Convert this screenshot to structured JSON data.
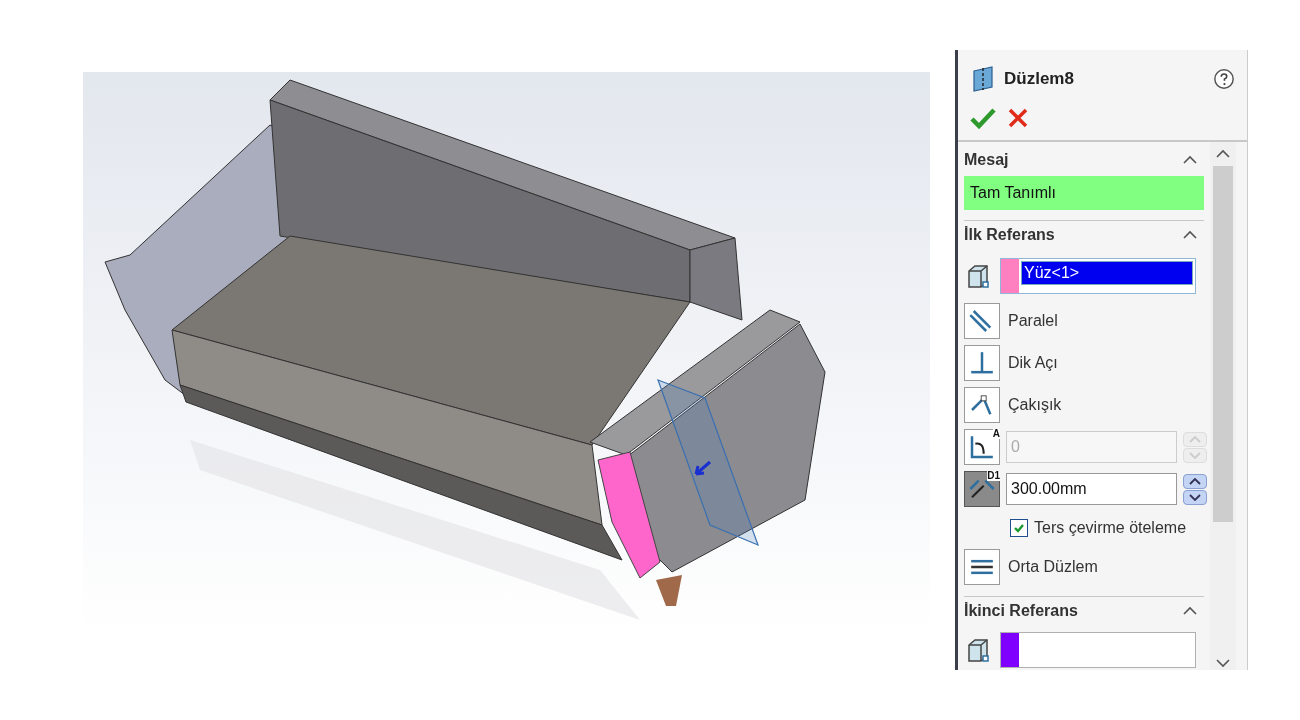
{
  "property_manager": {
    "title": "Düzlem8",
    "message_section": {
      "title": "Mesaj",
      "expanded": true,
      "message": "Tam Tanımlı"
    },
    "first_reference": {
      "title": "İlk Referans",
      "expanded": true,
      "selection": {
        "value": "Yüz<1>",
        "color": "#ff80c0",
        "selected": true
      },
      "options": [
        {
          "kind": "toggle",
          "label": "Paralel",
          "selected": false
        },
        {
          "kind": "toggle",
          "label": "Dik Açı",
          "selected": false
        },
        {
          "kind": "toggle",
          "label": "Çakışık",
          "selected": false
        },
        {
          "kind": "spin",
          "icon_label": "A",
          "value": "0",
          "disabled": true,
          "selected": false
        },
        {
          "kind": "spin",
          "icon_label": "D1",
          "value": "300.00mm",
          "disabled": false,
          "selected": true
        },
        {
          "kind": "checkbox",
          "label": "Ters çevirme öteleme",
          "checked": true
        },
        {
          "kind": "toggle",
          "label": "Orta Düzlem",
          "selected": false
        }
      ]
    },
    "second_reference": {
      "title": "İkinci Referans",
      "expanded": true,
      "selection": {
        "color": "#8000ff"
      }
    }
  }
}
